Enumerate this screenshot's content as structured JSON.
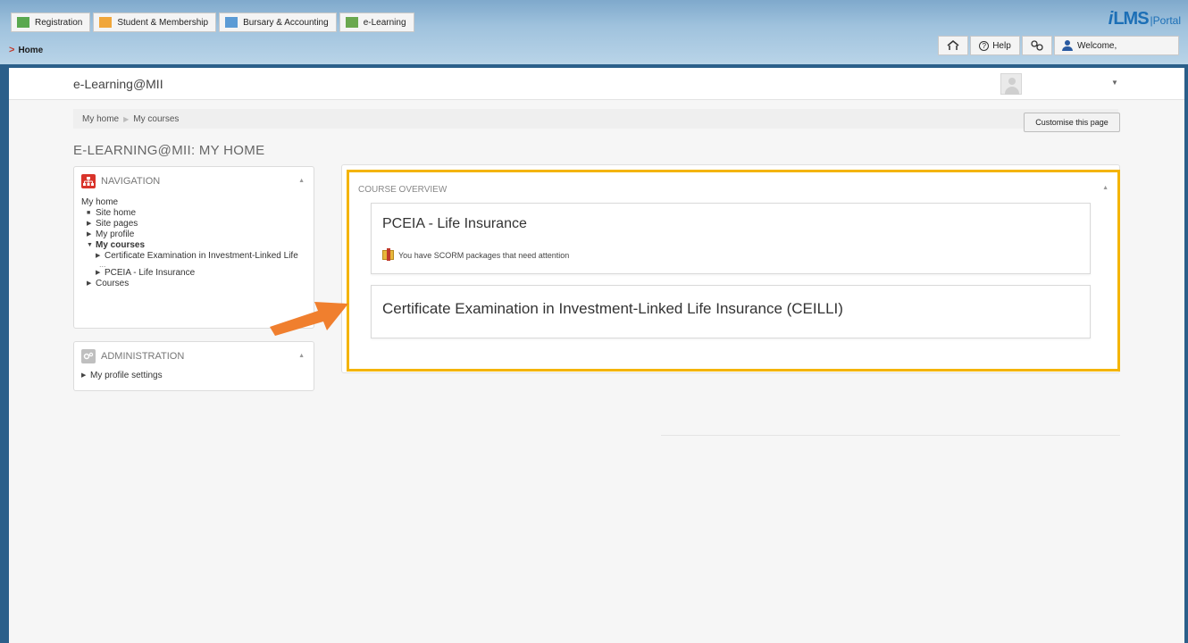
{
  "portal": {
    "module_tabs": [
      {
        "label": "Registration",
        "color": "#5aa84f"
      },
      {
        "label": "Student & Membership",
        "color": "#f0a63a"
      },
      {
        "label": "Bursary & Accounting",
        "color": "#5b9bd5"
      },
      {
        "label": "e-Learning",
        "color": "#6aa84f"
      }
    ],
    "home_label": "Home",
    "logo_i": "i",
    "logo_lms": "LMS",
    "logo_portal": "|Portal",
    "help_label": "Help",
    "welcome_label": "Welcome,"
  },
  "moodle": {
    "site_name": "e-Learning@MII",
    "breadcrumb": [
      "My home",
      "My courses"
    ],
    "customise_button": "Customise this page",
    "page_title": "E-LEARNING@MII: MY HOME"
  },
  "navigation_block": {
    "title": "NAVIGATION",
    "items": [
      {
        "label": "My home",
        "marker": "",
        "indent": 0,
        "bold": false
      },
      {
        "label": "Site home",
        "marker": "■",
        "indent": 1,
        "bold": false
      },
      {
        "label": "Site pages",
        "marker": "▶",
        "indent": 1,
        "bold": false
      },
      {
        "label": "My profile",
        "marker": "▶",
        "indent": 1,
        "bold": false
      },
      {
        "label": "My courses",
        "marker": "▼",
        "indent": 1,
        "bold": true
      },
      {
        "label": "Certificate Examination in Investment-Linked Life",
        "marker": "▶",
        "indent": 2,
        "bold": false
      },
      {
        "label": "PCEIA - Life Insurance",
        "marker": "▶",
        "indent": 2,
        "bold": false
      },
      {
        "label": "Courses",
        "marker": "▶",
        "indent": 1,
        "bold": false
      }
    ],
    "ellipsis": "..."
  },
  "administration_block": {
    "title": "ADMINISTRATION",
    "items": [
      {
        "label": "My profile settings",
        "marker": "▶"
      }
    ]
  },
  "course_overview": {
    "title": "COURSE OVERVIEW",
    "courses": [
      {
        "name": "PCEIA - Life Insurance",
        "note": "You have SCORM packages that need attention"
      },
      {
        "name": "Certificate Examination in Investment-Linked Life Insurance (CEILLI)",
        "note": ""
      }
    ],
    "highlight_color": "#f4b400",
    "arrow_color": "#f07f2e"
  }
}
